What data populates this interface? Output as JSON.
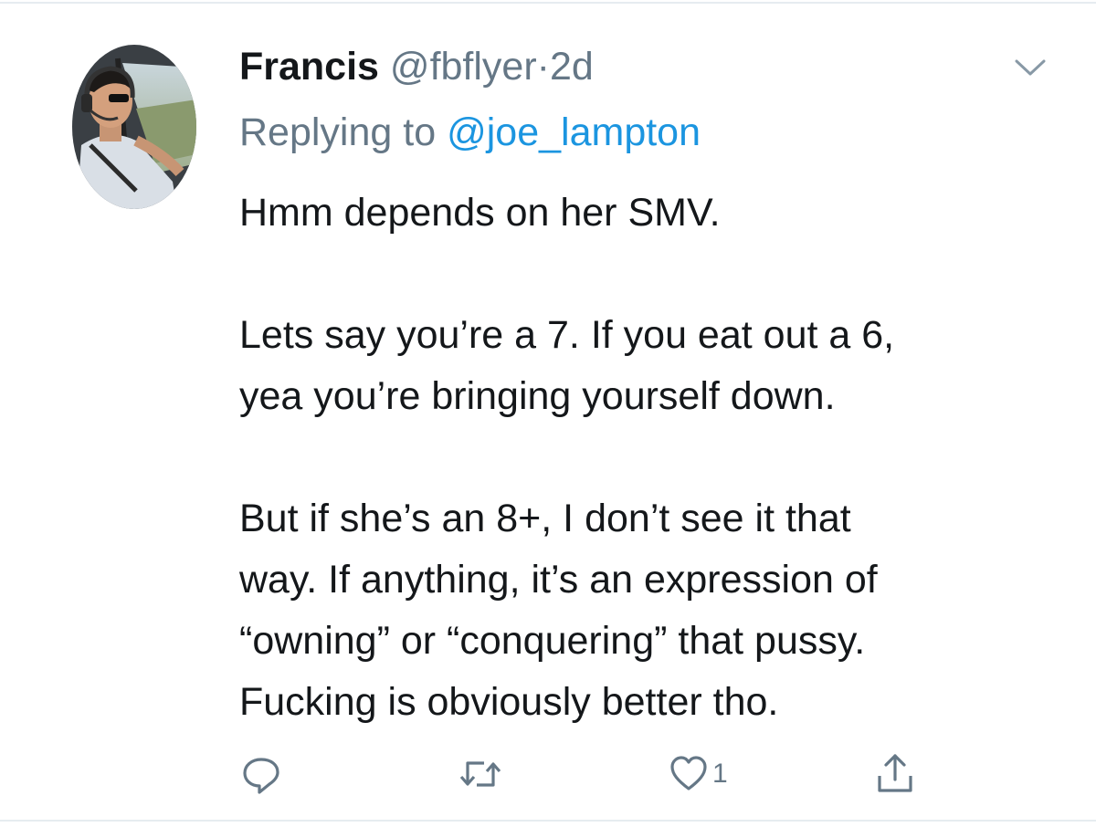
{
  "tweet": {
    "display_name": "Francis",
    "handle": "@fbflyer",
    "separator": "·",
    "time": "2d",
    "replying_prefix": "Replying to ",
    "replying_to": "@joe_lampton",
    "paragraphs": [
      [
        "Hmm depends on her SMV."
      ],
      [
        "Lets say you’re a 7. If you eat out a 6,",
        "yea you’re bringing yourself down."
      ],
      [
        "But if she’s an 8+, I don’t see it that",
        "way. If anything, it’s an expression of",
        "“owning” or “conquering” that pussy.",
        "Fucking is obviously better tho."
      ]
    ]
  },
  "actions": {
    "reply_icon": "reply-icon",
    "retweet_icon": "retweet-icon",
    "like_icon": "heart-icon",
    "like_count": "1",
    "share_icon": "share-icon"
  },
  "colors": {
    "text": "#14171a",
    "secondary": "#657786",
    "link": "#1b95e0",
    "divider": "#e6ecf0"
  }
}
